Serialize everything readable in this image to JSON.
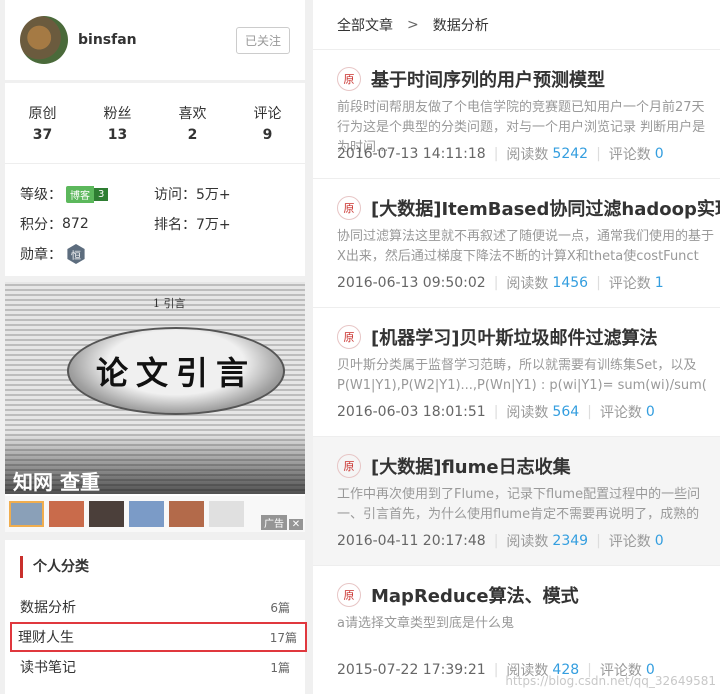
{
  "profile": {
    "username": "binsfan",
    "follow_label": "已关注"
  },
  "stats": [
    {
      "label": "原创",
      "value": "37"
    },
    {
      "label": "粉丝",
      "value": "13"
    },
    {
      "label": "喜欢",
      "value": "2"
    },
    {
      "label": "评论",
      "value": "9"
    }
  ],
  "levels": {
    "level_label": "等级：",
    "blog_badge": "博客",
    "blog_level": "3",
    "visits_label": "访问：",
    "visits_value": "5万+",
    "points_label": "积分：",
    "points_value": "872",
    "rank_label": "排名：",
    "rank_value": "7万+",
    "medal_label": "勋章：",
    "medal_glyph": "恒"
  },
  "ad": {
    "top_text": "1 引言",
    "lens_text": "论文引言",
    "title": "知网 查重",
    "ad_mark": "广告",
    "close": "✕",
    "thumb_colors": [
      "#8aa0b8",
      "#c96b4b",
      "#4b3f3a",
      "#7b9bc7",
      "#b36a4a",
      "#e0e0e0"
    ]
  },
  "categories": {
    "heading": "个人分类",
    "items": [
      {
        "name": "数据分析",
        "count": "6篇"
      },
      {
        "name": "理财人生",
        "count": "17篇"
      },
      {
        "name": "读书笔记",
        "count": "1篇"
      }
    ]
  },
  "breadcrumb": {
    "root": "全部文章",
    "sep": ">",
    "current": "数据分析"
  },
  "articles": [
    {
      "badge": "原",
      "title": "基于时间序列的用户预测模型",
      "summary1": "前段时间帮朋友做了个电信学院的竞赛题已知用户一个月前27天",
      "summary2": "行为这是个典型的分类问题，对与一个用户浏览记录 判断用户是",
      "summary3": "为时间...",
      "date": "2016-07-13 14:11:18",
      "reads_label": "阅读数",
      "reads": "5242",
      "comments_label": "评论数",
      "comments": "0"
    },
    {
      "badge": "原",
      "title": "[大数据]ItemBased协同过滤hadoop实现",
      "summary1": "协同过滤算法这里就不再叙述了随便说一点，通常我们使用的基于",
      "summary2": "X出来，然后通过梯度下降法不断的计算X和theta使costFunct",
      "summary3": "",
      "date": "2016-06-13 09:50:02",
      "reads_label": "阅读数",
      "reads": "1456",
      "comments_label": "评论数",
      "comments": "1"
    },
    {
      "badge": "原",
      "title": "[机器学习]贝叶斯垃圾邮件过滤算法",
      "summary1": "贝叶斯分类属于监督学习范畴，所以就需要有训练集Set，以及",
      "summary2": "P(W1|Y1),P(W2|Y1)...,P(Wn|Y1)   : p(wi|Y1)= sum(wi)/sum(",
      "summary3": "",
      "date": "2016-06-03 18:01:51",
      "reads_label": "阅读数",
      "reads": "564",
      "comments_label": "评论数",
      "comments": "0"
    },
    {
      "badge": "原",
      "title": "[大数据]flume日志收集",
      "summary1": "工作中再次使用到了Flume，记录下flume配置过程中的一些问",
      "summary2": "一、引言首先，为什么使用flume肯定不需要再说明了，成熟的",
      "summary3": "",
      "date": "2016-04-11 20:17:48",
      "reads_label": "阅读数",
      "reads": "2349",
      "comments_label": "评论数",
      "comments": "0"
    },
    {
      "badge": "原",
      "title": "MapReduce算法、模式",
      "summary1": "a请选择文章类型到底是什么鬼",
      "summary2": "",
      "summary3": "",
      "date": "2015-07-22 17:39:21",
      "reads_label": "阅读数",
      "reads": "428",
      "comments_label": "评论数",
      "comments": "0"
    }
  ],
  "watermark": "https://blog.csdn.net/qq_32649581"
}
